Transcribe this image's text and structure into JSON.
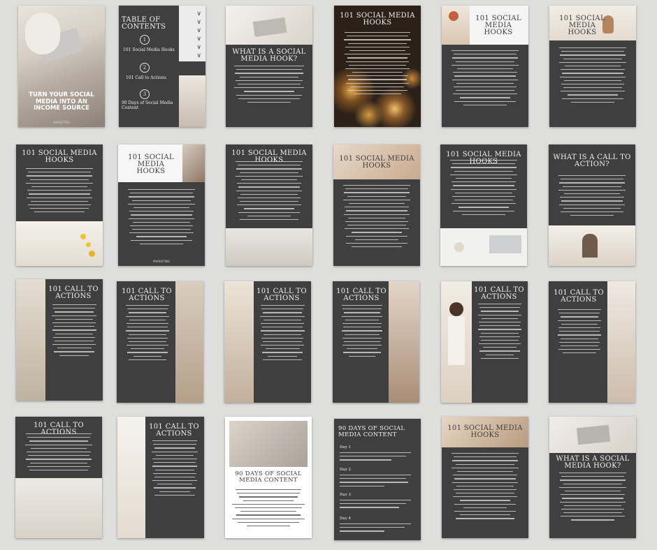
{
  "pages": {
    "cover": {
      "title": "TURN YOUR SOCIAL MEDIA INTO AN INCOME SOURCE",
      "footer": "MARKETING"
    },
    "toc": {
      "title": "TABLE OF CONTENTS",
      "items": [
        {
          "num": "1",
          "label": "101 Social Media Hooks"
        },
        {
          "num": "2",
          "label": "101 Call to Actions"
        },
        {
          "num": "3",
          "label": "90 Days of Social Media Content"
        }
      ]
    },
    "what_hook": {
      "title": "WHAT IS A SOCIAL MEDIA HOOK?"
    },
    "hooks": {
      "title": "101 SOCIAL MEDIA HOOKS"
    },
    "cta": {
      "title": "101 CALL TO ACTIONS"
    },
    "what_cta": {
      "title": "WHAT IS A CALL TO ACTION?"
    },
    "days": {
      "title": "90 DAYS OF SOCIAL MEDIA CONTENT",
      "day_labels": [
        "Day 1",
        "Day 2",
        "Day 3",
        "Day 4"
      ]
    },
    "footer_mark": "MARKETING"
  },
  "colors": {
    "page_dark": "#3f3f3f",
    "page_light": "#ffffff",
    "background": "#dededc"
  }
}
